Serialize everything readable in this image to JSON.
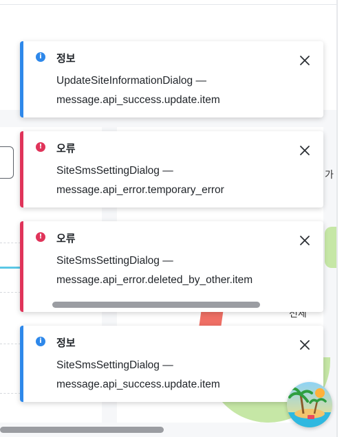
{
  "background": {
    "glyph_right": "가",
    "glyph_bottom": "전체"
  },
  "toasts": [
    {
      "severity": "info",
      "title": "정보",
      "line1": "UpdateSiteInformationDialog —",
      "line2": "message.api_success.update.item",
      "icon": "info-icon"
    },
    {
      "severity": "error",
      "title": "오류",
      "line1": "SiteSmsSettingDialog —",
      "line2": "message.api_error.temporary_error",
      "icon": "error-icon"
    },
    {
      "severity": "error",
      "title": "오류",
      "line1": "SiteSmsSettingDialog —",
      "line2": "message.api_error.deleted_by_other.item",
      "icon": "error-icon"
    },
    {
      "severity": "info",
      "title": "정보",
      "line1": "SiteSmsSettingDialog —",
      "line2": "message.api_success.update.item",
      "icon": "info-icon"
    }
  ],
  "colors": {
    "info": "#2e88ea",
    "error": "#e0345a",
    "text": "#1f2328"
  },
  "fab": {
    "icon": "tropical-island-icon"
  }
}
